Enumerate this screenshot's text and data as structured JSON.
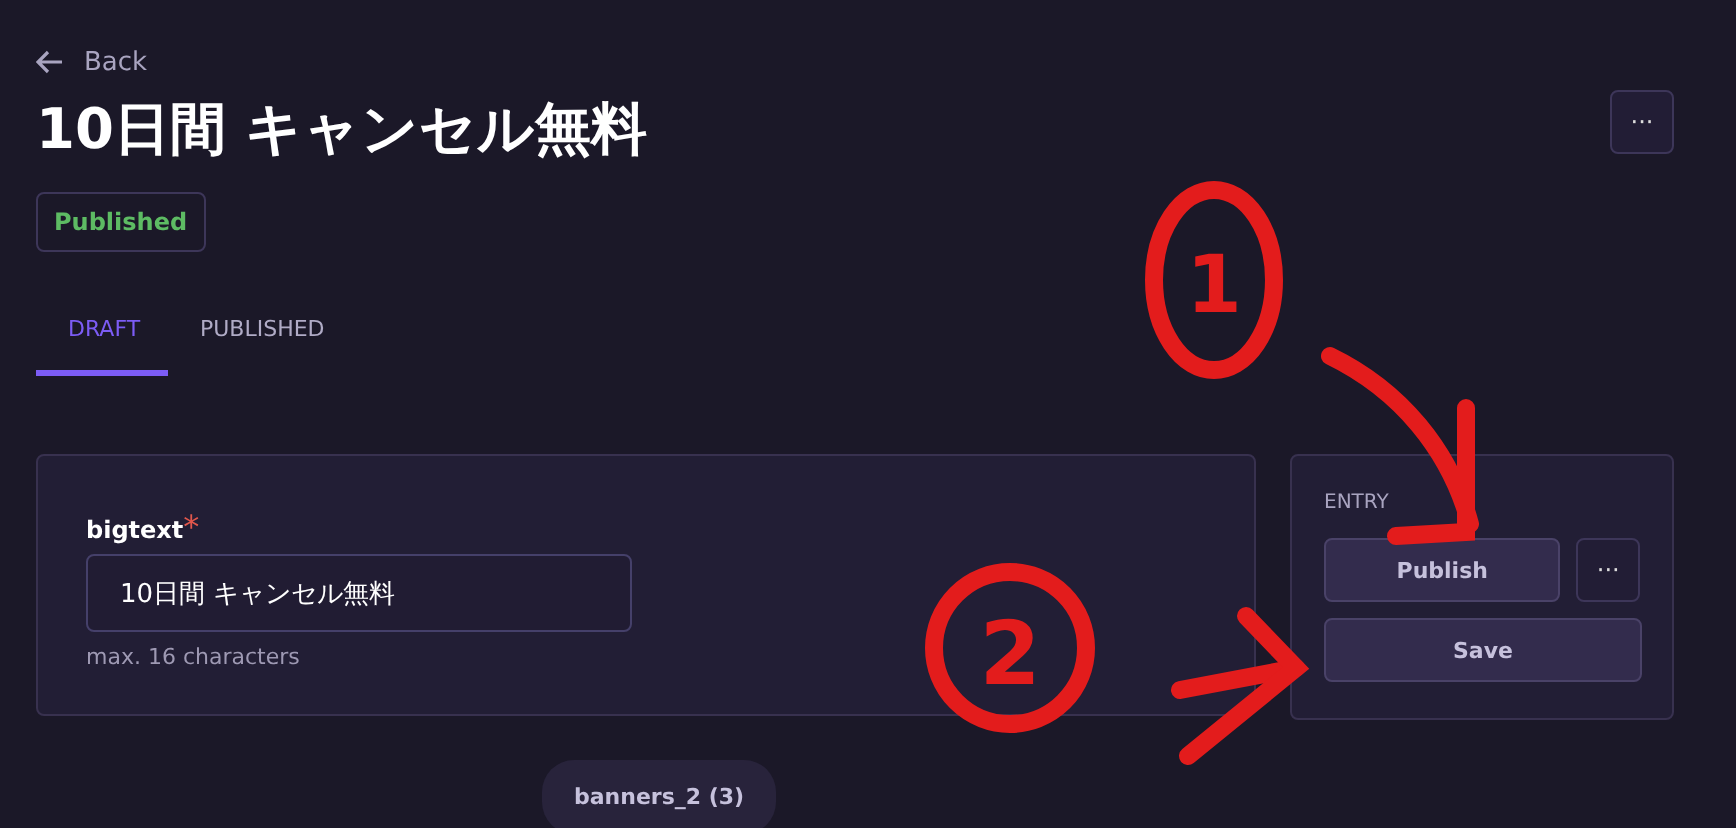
{
  "back": {
    "label": "Back"
  },
  "title": "10日間 キャンセル無料",
  "status_badge": "Published",
  "header_menu": "···",
  "tabs": [
    {
      "label": "DRAFT",
      "selected": true
    },
    {
      "label": "PUBLISHED",
      "selected": false
    }
  ],
  "field": {
    "label": "bigtext",
    "required_mark": "*",
    "value": "10日間 キャンセル無料",
    "hint": "max. 16 characters"
  },
  "entry_panel": {
    "heading": "ENTRY",
    "publish": "Publish",
    "more": "···",
    "save": "Save"
  },
  "section_pill": "banners_2 (3)",
  "annotations": [
    {
      "label": "1"
    },
    {
      "label": "2"
    }
  ]
}
